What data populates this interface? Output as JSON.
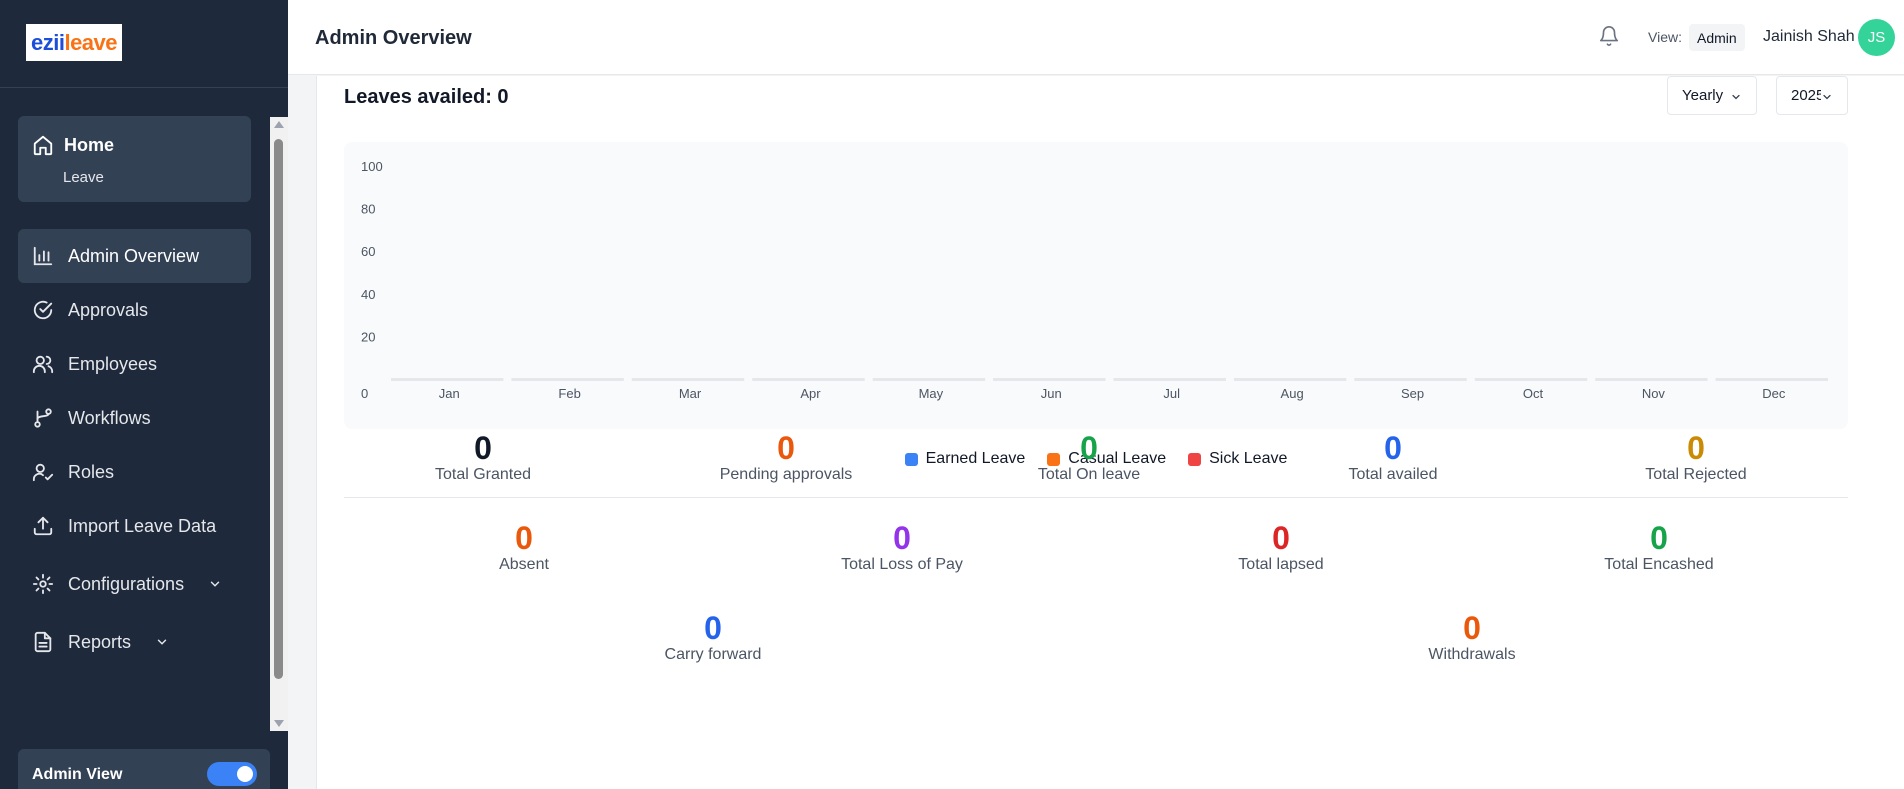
{
  "app": {
    "logo_part1": "ezii",
    "logo_part2": "leave"
  },
  "sidebar": {
    "home": {
      "label": "Home",
      "sub": "Leave"
    },
    "items": [
      {
        "label": "Admin Overview",
        "icon": "bar-chart-icon",
        "active": true
      },
      {
        "label": "Approvals",
        "icon": "check-circle-icon"
      },
      {
        "label": "Employees",
        "icon": "users-icon"
      },
      {
        "label": "Workflows",
        "icon": "workflow-icon"
      },
      {
        "label": "Roles",
        "icon": "user-check-icon"
      },
      {
        "label": "Import Leave Data",
        "icon": "upload-icon"
      },
      {
        "label": "Configurations",
        "icon": "gear-icon",
        "expandable": true
      },
      {
        "label": "Reports",
        "icon": "file-icon",
        "expandable": true
      }
    ],
    "admin_view": {
      "label": "Admin View",
      "enabled": true
    }
  },
  "header": {
    "title": "Admin Overview",
    "view_label": "View:",
    "view_value": "Admin",
    "user_name": "Jainish Shah",
    "avatar_initials": "JS"
  },
  "main": {
    "leaves_title": "Leaves availed: 0",
    "period_select": "Yearly",
    "year_select": "2025"
  },
  "chart_data": {
    "type": "bar",
    "categories": [
      "Jan",
      "Feb",
      "Mar",
      "Apr",
      "May",
      "Jun",
      "Jul",
      "Aug",
      "Sep",
      "Oct",
      "Nov",
      "Dec"
    ],
    "series": [
      {
        "name": "Earned Leave",
        "color": "#3b82f6",
        "values": [
          0,
          0,
          0,
          0,
          0,
          0,
          0,
          0,
          0,
          0,
          0,
          0
        ]
      },
      {
        "name": "Casual Leave",
        "color": "#f97316",
        "values": [
          0,
          0,
          0,
          0,
          0,
          0,
          0,
          0,
          0,
          0,
          0,
          0
        ]
      },
      {
        "name": "Sick Leave",
        "color": "#ef4444",
        "values": [
          0,
          0,
          0,
          0,
          0,
          0,
          0,
          0,
          0,
          0,
          0,
          0
        ]
      }
    ],
    "yticks": [
      "0",
      "20",
      "40",
      "60",
      "80",
      "100"
    ],
    "ylim": [
      0,
      100
    ],
    "legend_position": "bottom"
  },
  "stats": [
    {
      "label": "Total Granted",
      "value": "0",
      "color": "#111827"
    },
    {
      "label": "Pending approvals",
      "value": "0",
      "color": "#ea580c"
    },
    {
      "label": "Total On leave",
      "value": "0",
      "color": "#16a34a"
    },
    {
      "label": "Total availed",
      "value": "0",
      "color": "#2563eb"
    },
    {
      "label": "Total Rejected",
      "value": "0",
      "color": "#ca8a04"
    },
    {
      "label": "Absent",
      "value": "0",
      "color": "#ea580c"
    },
    {
      "label": "Total Loss of Pay",
      "value": "0",
      "color": "#9333ea"
    },
    {
      "label": "Total lapsed",
      "value": "0",
      "color": "#dc2626"
    },
    {
      "label": "Total Encashed",
      "value": "0",
      "color": "#16a34a"
    },
    {
      "label": "Carry forward",
      "value": "0",
      "color": "#2563eb"
    },
    {
      "label": "Withdrawals",
      "value": "0",
      "color": "#ea580c"
    }
  ]
}
